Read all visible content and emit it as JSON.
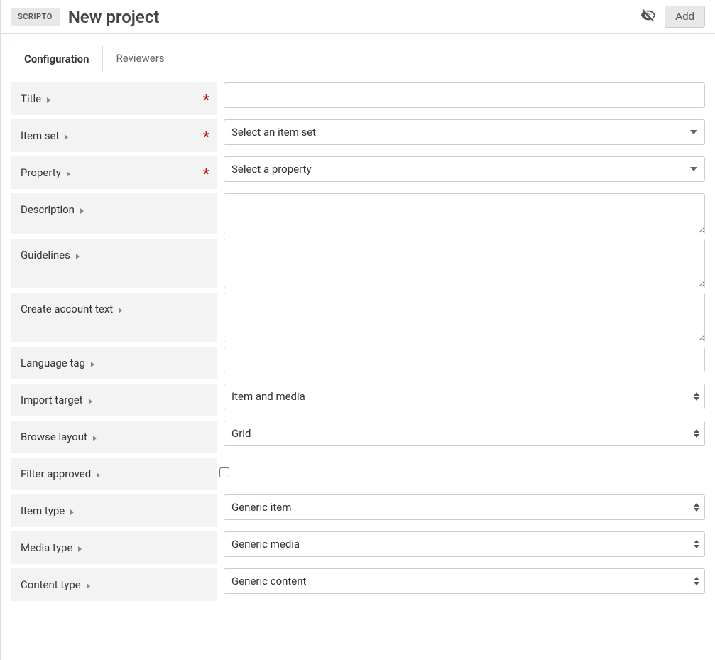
{
  "header": {
    "badge": "SCRIPTO",
    "title": "New project",
    "add_label": "Add"
  },
  "tabs": {
    "configuration": "Configuration",
    "reviewers": "Reviewers"
  },
  "fields": {
    "title": {
      "label": "Title",
      "required": true
    },
    "item_set": {
      "label": "Item set",
      "required": true,
      "placeholder": "Select an item set"
    },
    "property": {
      "label": "Property",
      "required": true,
      "placeholder": "Select a property"
    },
    "description": {
      "label": "Description"
    },
    "guidelines": {
      "label": "Guidelines"
    },
    "create_account_text": {
      "label": "Create account text"
    },
    "language_tag": {
      "label": "Language tag"
    },
    "import_target": {
      "label": "Import target",
      "value": "Item and media"
    },
    "browse_layout": {
      "label": "Browse layout",
      "value": "Grid"
    },
    "filter_approved": {
      "label": "Filter approved"
    },
    "item_type": {
      "label": "Item type",
      "value": "Generic item"
    },
    "media_type": {
      "label": "Media type",
      "value": "Generic media"
    },
    "content_type": {
      "label": "Content type",
      "value": "Generic content"
    }
  }
}
